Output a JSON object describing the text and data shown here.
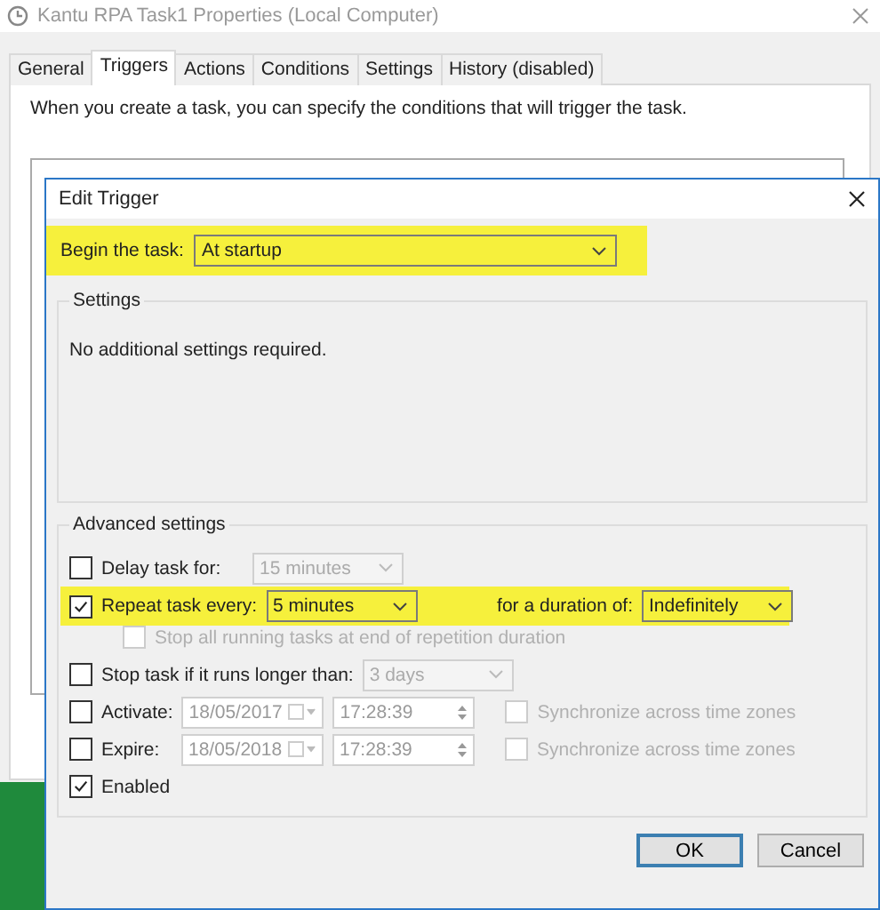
{
  "window": {
    "title": "Kantu RPA Task1 Properties (Local Computer)"
  },
  "tabs": [
    {
      "label": "General",
      "selected": false
    },
    {
      "label": "Triggers",
      "selected": true
    },
    {
      "label": "Actions",
      "selected": false
    },
    {
      "label": "Conditions",
      "selected": false
    },
    {
      "label": "Settings",
      "selected": false
    },
    {
      "label": "History (disabled)",
      "selected": false
    }
  ],
  "description": "When you create a task, you can specify the conditions that will trigger the task.",
  "dialog": {
    "title": "Edit Trigger",
    "begin": {
      "label": "Begin the task:",
      "value": "At startup",
      "highlighted": true
    },
    "settings": {
      "title": "Settings",
      "message": "No additional settings required."
    },
    "advanced": {
      "title": "Advanced settings",
      "rows": [
        {
          "kind": "combo",
          "label": "Delay task for:",
          "checked": false,
          "value": "15 minutes",
          "disabled": true
        },
        {
          "kind": "repeat",
          "label": "Repeat task every:",
          "checked": true,
          "value": "5 minutes",
          "disabled": false,
          "highlighted": true,
          "duration_label": "for a duration of:",
          "duration_value": "Indefinitely"
        },
        {
          "kind": "sub",
          "label": "Stop all running tasks at end of repetition duration",
          "checked": false,
          "disabled": true
        },
        {
          "kind": "combo",
          "label": "Stop task if it runs longer than:",
          "checked": false,
          "value": "3 days",
          "disabled": true
        },
        {
          "kind": "date",
          "label": "Activate:",
          "checked": false,
          "date": "18/05/2017",
          "time": "17:28:39",
          "sync_checked": false,
          "sync_label": "Synchronize across time zones",
          "disabled": true
        },
        {
          "kind": "date",
          "label": "Expire:",
          "checked": false,
          "date": "18/05/2018",
          "time": "17:28:39",
          "sync_checked": false,
          "sync_label": "Synchronize across time zones",
          "disabled": true
        },
        {
          "kind": "check",
          "label": "Enabled",
          "checked": true
        }
      ]
    },
    "buttons": [
      {
        "label": "OK",
        "default": true
      },
      {
        "label": "Cancel",
        "default": false
      }
    ]
  }
}
